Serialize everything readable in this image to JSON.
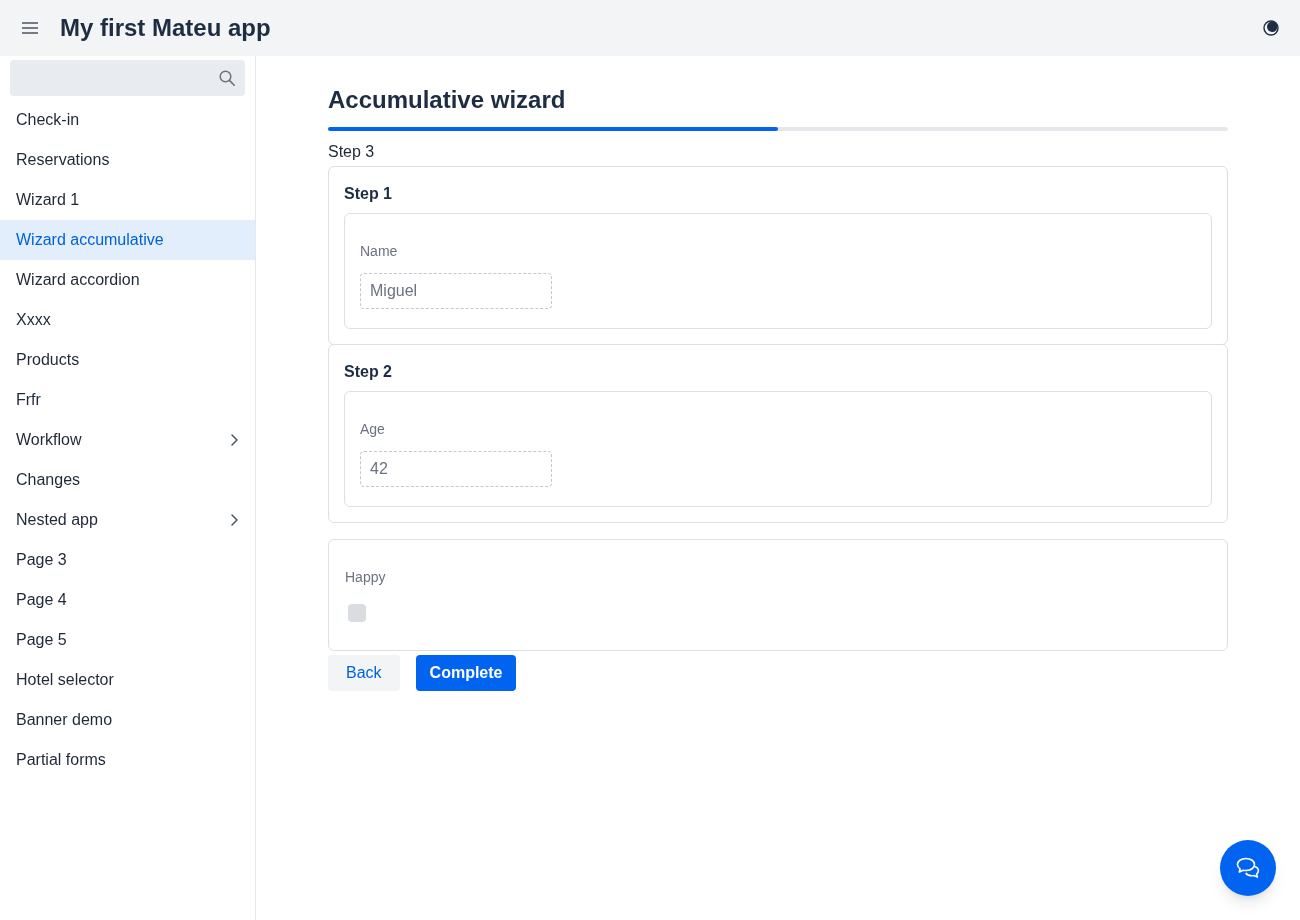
{
  "header": {
    "title": "My first Mateu app"
  },
  "sidebar": {
    "items": [
      {
        "label": "Check-in",
        "selected": false,
        "submenu": false
      },
      {
        "label": "Reservations",
        "selected": false,
        "submenu": false
      },
      {
        "label": "Wizard 1",
        "selected": false,
        "submenu": false
      },
      {
        "label": "Wizard accumulative",
        "selected": true,
        "submenu": false
      },
      {
        "label": "Wizard accordion",
        "selected": false,
        "submenu": false
      },
      {
        "label": "Xxxx",
        "selected": false,
        "submenu": false
      },
      {
        "label": "Products",
        "selected": false,
        "submenu": false
      },
      {
        "label": "Frfr",
        "selected": false,
        "submenu": false
      },
      {
        "label": "Workflow",
        "selected": false,
        "submenu": true
      },
      {
        "label": "Changes",
        "selected": false,
        "submenu": false
      },
      {
        "label": "Nested app",
        "selected": false,
        "submenu": true
      },
      {
        "label": "Page 3",
        "selected": false,
        "submenu": false
      },
      {
        "label": "Page 4",
        "selected": false,
        "submenu": false
      },
      {
        "label": "Page 5",
        "selected": false,
        "submenu": false
      },
      {
        "label": "Hotel selector",
        "selected": false,
        "submenu": false
      },
      {
        "label": "Banner demo",
        "selected": false,
        "submenu": false
      },
      {
        "label": "Partial forms",
        "selected": false,
        "submenu": false
      }
    ]
  },
  "wizard": {
    "title": "Accumulative wizard",
    "progress": {
      "level": 0.5
    },
    "current_step": "Step 3",
    "completed_steps": [
      {
        "title": "Step 1",
        "fields": [
          {
            "label": "Name",
            "value": "Miguel",
            "readonly": true
          }
        ]
      },
      {
        "title": "Step 2",
        "fields": [
          {
            "label": "Age",
            "value": "42",
            "readonly": true
          }
        ]
      }
    ],
    "current_fields": [
      {
        "kind": "checkbox",
        "label": "Happy",
        "checked": false
      }
    ],
    "buttons": [
      {
        "label": "Back",
        "kind": "secondary"
      },
      {
        "label": "Complete",
        "kind": "primary"
      }
    ]
  }
}
